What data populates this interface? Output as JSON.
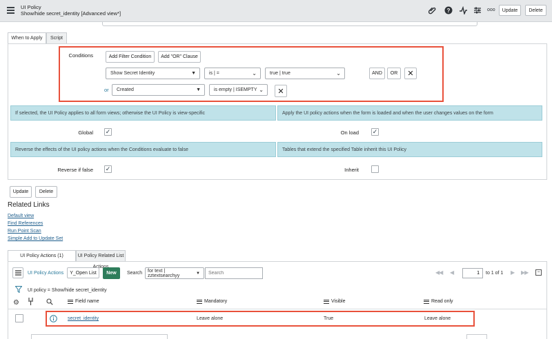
{
  "header": {
    "title": "UI Policy",
    "subtitle": "Show/hide secret_identity [Advanced view*]",
    "update_label": "Update",
    "delete_label": "Delete",
    "more_label": "ooo"
  },
  "tabs": {
    "when_to_apply": "When to Apply",
    "script": "Script"
  },
  "conditions": {
    "label": "Conditions",
    "add_filter": "Add Filter Condition",
    "add_or": "Add \"OR\" Clause",
    "row1": {
      "field": "Show Secret Identity",
      "operator": "is | =",
      "value": "true | true"
    },
    "and_label": "AND",
    "or_label": "OR",
    "or_prefix": "or",
    "row2": {
      "field": "Created",
      "operator": "is empty | ISEMPTY"
    }
  },
  "info": {
    "global_help": "If selected, the UI Policy applies to all form views; otherwise the UI Policy is view-specific",
    "onload_help": "Apply the UI policy actions when the form is loaded and when the user changes values on the form",
    "reverse_help": "Reverse the effects of the UI policy actions when the Conditions evaluate to false",
    "inherit_help": "Tables that extend the specified Table inherit this UI Policy"
  },
  "fields": {
    "global": "Global",
    "on_load": "On load",
    "reverse": "Reverse if false",
    "inherit": "Inherit",
    "global_checked": true,
    "on_load_checked": true,
    "reverse_checked": true,
    "inherit_checked": false
  },
  "bottom_buttons": {
    "update": "Update",
    "delete": "Delete"
  },
  "related_links": {
    "title": "Related Links",
    "items": [
      "Default view",
      "Find References",
      "Run Point Scan",
      "Simple Add to Update Set"
    ]
  },
  "related_tabs": [
    "UI Policy Actions (1)",
    "UI Policy Related List Actions"
  ],
  "list": {
    "menu_label": "UI Policy Actions",
    "open_list": "Y_Open List",
    "new_label": "New",
    "search_label": "Search",
    "search_scope": "for text | zztextsearchyy",
    "search_placeholder": "Search",
    "page_value": "1",
    "page_of": "to 1 of 1",
    "breadcrumb": "UI policy = Show/hide secret_identity",
    "columns": [
      "Field name",
      "Mandatory",
      "Visible",
      "Read only"
    ],
    "rows": [
      {
        "field": "secret_identity",
        "mandatory": "Leave alone",
        "visible": "True",
        "read_only": "Leave alone"
      }
    ]
  },
  "colors": {
    "accent_red": "#e8503a",
    "new_green": "#2e7d5b",
    "info_blue": "#bfe2e9"
  }
}
